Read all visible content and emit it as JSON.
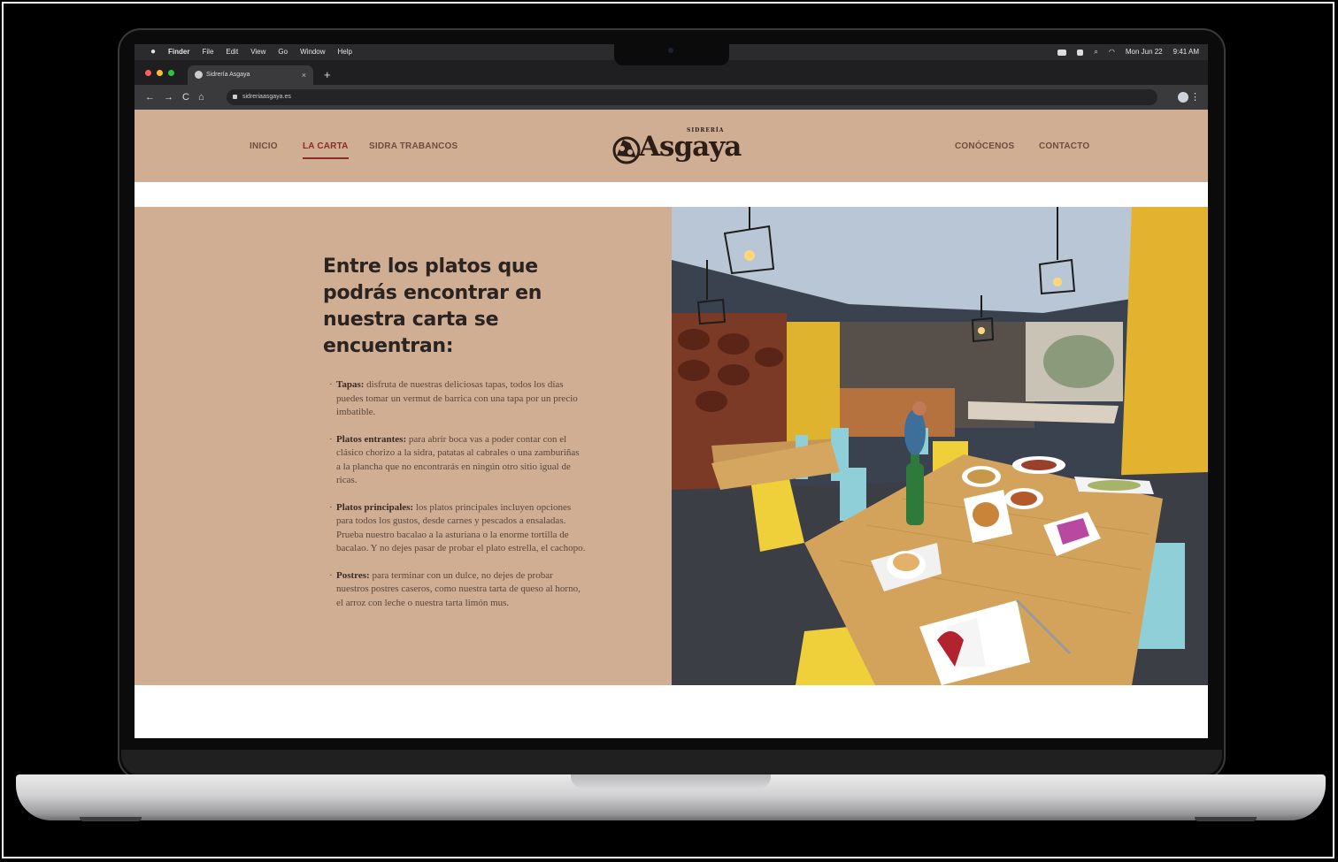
{
  "menubar": {
    "apple": "",
    "items": [
      "Finder",
      "File",
      "Edit",
      "View",
      "Go",
      "Window",
      "Help"
    ],
    "date": "Mon Jun 22",
    "time": "9:41 AM"
  },
  "browser": {
    "tab_title": "Sidrería Asgaya",
    "tab_close": "×",
    "new_tab": "+",
    "url": "sidreriaasgaya.es",
    "nav": {
      "back": "←",
      "forward": "→",
      "reload": "C",
      "home": "⌂"
    },
    "menu": "⋮"
  },
  "site": {
    "nav_left": [
      "INICIO",
      "LA CARTA",
      "SIDRA TRABANCOS"
    ],
    "nav_right": [
      "CONÓCENOS",
      "CONTACTO"
    ],
    "active_nav": "LA CARTA",
    "logo_small": "SIDRERÍA",
    "logo_word": "Asgaya",
    "heading": "Entre los platos que podrás encontrar en nuestra carta se encuentran:",
    "items": [
      {
        "title": "Tapas:",
        "text": " disfruta de nuestras deliciosas tapas, todos los días puedes tomar un vermut de barrica con una tapa por un precio imbatible."
      },
      {
        "title": "Platos entrantes:",
        "text": " para abrir boca vas a poder contar con el clásico chorizo a la sidra, patatas al cabrales o una zamburiñas a la plancha que no encontrarás en ningún otro sitio igual de ricas."
      },
      {
        "title": "Platos principales:",
        "text": " los platos principales incluyen opciones para todos los gustos, desde carnes y pescados a ensaladas. Prueba nuestro bacalao a la asturiana o la enorme tortilla de bacalao. Y no dejes pasar de probar el plato estrella, el cachopo."
      },
      {
        "title": "Postres:",
        "text": " para terminar con un dulce, no dejes de probar nuestros postres caseros, como nuestra tarta de queso al horno, el arroz con leche o nuestra tarta limón mus."
      }
    ]
  },
  "colors": {
    "brand_tan": "#cfae94",
    "active_red": "#8a2a2a",
    "nav_brown": "#6d4e3c"
  }
}
